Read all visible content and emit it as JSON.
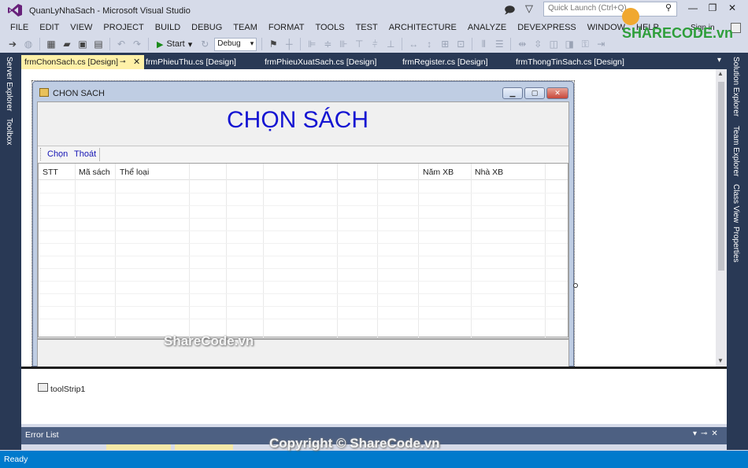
{
  "window": {
    "title": "QuanLyNhaSach - Microsoft Visual Studio"
  },
  "quick_launch": {
    "placeholder": "Quick Launch (Ctrl+Q)"
  },
  "menu": [
    "FILE",
    "EDIT",
    "VIEW",
    "PROJECT",
    "BUILD",
    "DEBUG",
    "TEAM",
    "FORMAT",
    "TOOLS",
    "TEST",
    "ARCHITECTURE",
    "ANALYZE",
    "DEVEXPRESS",
    "WINDOW",
    "HELP"
  ],
  "account": {
    "sign_in": "Sign in"
  },
  "toolbar": {
    "start_label": "Start",
    "config_value": "Debug"
  },
  "left_tool_tabs": [
    "Server Explorer",
    "Toolbox"
  ],
  "right_tool_tabs": [
    "Solution Explorer",
    "Team Explorer",
    "Class View",
    "Properties"
  ],
  "tabs": [
    {
      "label": "frmChonSach.cs [Design]",
      "active": true
    },
    {
      "label": "frmPhieuThu.cs [Design]",
      "active": false
    },
    {
      "label": "frmPhieuXuatSach.cs [Design]",
      "active": false
    },
    {
      "label": "frmRegister.cs [Design]",
      "active": false
    },
    {
      "label": "frmThongTinSach.cs [Design]",
      "active": false
    }
  ],
  "form": {
    "title": "CHON SACH",
    "heading": "CHỌN SÁCH",
    "menustrip": [
      "Chọn",
      "Thoát"
    ],
    "columns": [
      "STT",
      "Mã sách",
      "Thể loại",
      "",
      "",
      "",
      "",
      "",
      "",
      "Năm XB",
      "Nhà XB"
    ]
  },
  "component_tray": {
    "item": "toolStrip1"
  },
  "error_list": {
    "title": "Error List"
  },
  "status": {
    "text": "Ready"
  },
  "watermarks": {
    "logo": "SHARECODE.vn",
    "center": "ShareCode.vn",
    "bottom": "Copyright © ShareCode.vn"
  },
  "colors": {
    "accent": "#007acc",
    "active_tab": "#fff1a8",
    "tool_rail": "#293955",
    "heading": "#1414d2"
  }
}
